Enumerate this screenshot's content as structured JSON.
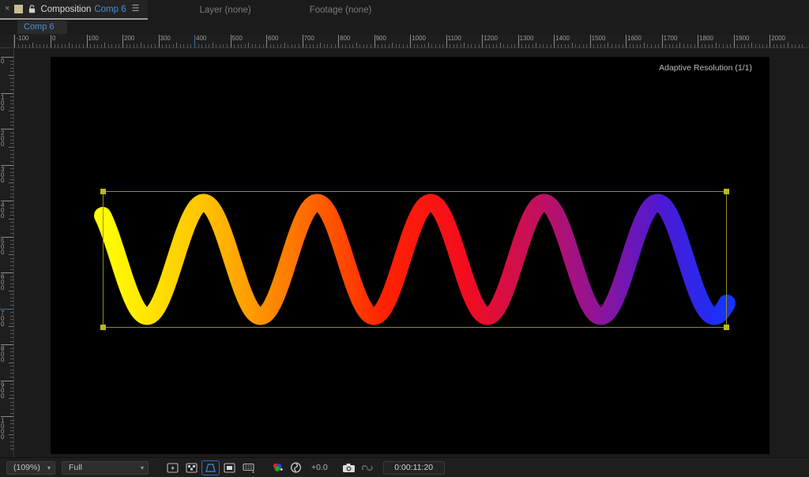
{
  "app": {
    "name": "Adobe After Effects",
    "theme_bg": "#1b1b1b",
    "accent_blue": "#4a8fd8",
    "selection_yellow": "#b9b91d"
  },
  "panel_tabs": [
    {
      "id": "composition",
      "close": "×",
      "lock_icon": "lock-icon",
      "label": "Composition",
      "comp_name": "Comp 6",
      "menu_icon": "panel-menu-icon",
      "active": true
    },
    {
      "id": "layer",
      "label": "Layer (none)",
      "active": false
    },
    {
      "id": "footage",
      "label": "Footage (none)",
      "active": false
    }
  ],
  "breadcrumb": {
    "items": [
      {
        "label": "Comp 6"
      }
    ]
  },
  "viewer": {
    "adaptive_resolution": "Adaptive Resolution (1/1)",
    "background_color": "#000000"
  },
  "rulers": {
    "horizontal": {
      "labels": [
        "-100",
        "0",
        "100",
        "200",
        "300",
        "400",
        "500",
        "600",
        "700",
        "800",
        "900",
        "1000",
        "1100",
        "1200",
        "1300",
        "1400",
        "1500",
        "1600",
        "1700",
        "1800",
        "1900",
        "2000"
      ],
      "unit_step": 100,
      "guide_positions": [
        "400"
      ]
    },
    "vertical": {
      "labels": [
        "0",
        "100",
        "200",
        "300",
        "400",
        "500",
        "600",
        "700",
        "800",
        "900",
        "1000"
      ],
      "unit_step": 100,
      "guide_positions": [
        "700"
      ]
    }
  },
  "chart_data": {
    "type": "line",
    "title": "Rainbow Sine Wave",
    "xlabel": "",
    "ylabel": "",
    "description": "Continuous sine wave, ~5.5 cycles, stroked with a round-cap ribbon whose color sweeps left-to-right through a rainbow ramp.",
    "cycles": 5.5,
    "amplitude": 72,
    "stroke_width": 22,
    "xlim": [
      0,
      790
    ],
    "ylim": [
      -86,
      86
    ],
    "grid": false,
    "legend": false,
    "gradient_stops": [
      {
        "offset": 0.0,
        "color": "#ffff00"
      },
      {
        "offset": 0.16,
        "color": "#ffc400"
      },
      {
        "offset": 0.3,
        "color": "#ff7a00"
      },
      {
        "offset": 0.45,
        "color": "#ff2200"
      },
      {
        "offset": 0.58,
        "color": "#f40c1e"
      },
      {
        "offset": 0.7,
        "color": "#c01060"
      },
      {
        "offset": 0.8,
        "color": "#8b149c"
      },
      {
        "offset": 0.9,
        "color": "#4a1ad4"
      },
      {
        "offset": 1.0,
        "color": "#1533ff"
      }
    ],
    "peaks_y": [
      86,
      86,
      86,
      86,
      86,
      86
    ],
    "troughs_y": [
      -86,
      -86,
      -86,
      -86,
      -86
    ]
  },
  "selection": {
    "handle_count": 4,
    "border_color": "#8f8f17",
    "handle_color": "#b9b91d"
  },
  "bottom_toolbar": {
    "zoom": {
      "value": "(109%)",
      "caret": "chevron-down-icon"
    },
    "resolution": {
      "value": "Full",
      "caret": "chevron-down-icon"
    },
    "buttons": [
      {
        "id": "region-of-interest",
        "icon": "region-of-interest-icon",
        "label": "Region of Interest",
        "active": false
      },
      {
        "id": "transparency-grid",
        "icon": "transparency-grid-icon",
        "label": "Toggle Transparency Grid",
        "active": false
      },
      {
        "id": "grid-guides",
        "icon": "grid-and-guide-options-icon",
        "label": "Choose grid and guide options",
        "active": true
      },
      {
        "id": "mask-shape",
        "icon": "mask-shape-visibility-icon",
        "label": "Toggle Mask and Shape Path Visibility",
        "active": false
      },
      {
        "id": "preview-time",
        "icon": "preview-time-icon",
        "label": "Preview Time",
        "active": false
      }
    ],
    "channel_icon": "channel-rgb-icon",
    "exposure_icon": "exposure-icon",
    "exposure_value": "+0.0",
    "snapshot_icon": "take-snapshot-icon",
    "show_snapshot_icon": "show-snapshot-icon",
    "timecode": "0:00:11:20"
  }
}
